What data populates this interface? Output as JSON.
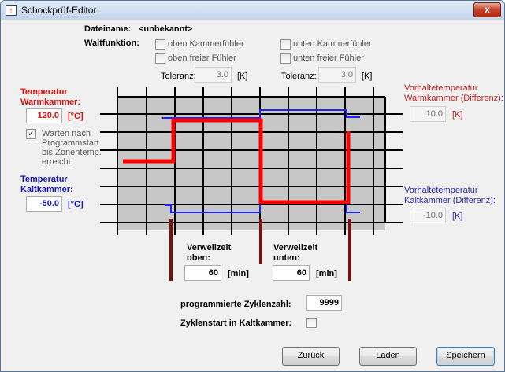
{
  "window": {
    "title": "Schockprüf-Editor",
    "close_glyph": "x"
  },
  "file": {
    "label": "Dateiname:",
    "value": "<unbekannt>"
  },
  "wait": {
    "label": "Waitfunktion:",
    "options": [
      {
        "label": "oben Kammerfühler",
        "checked": false
      },
      {
        "label": "oben freier Fühler",
        "checked": false
      },
      {
        "label": "unten Kammerfühler",
        "checked": false
      },
      {
        "label": "unten freier Fühler",
        "checked": false
      }
    ],
    "tol_label": "Toleranz:",
    "tol_left": "3.0",
    "tol_right": "3.0",
    "tol_unit": "[K]"
  },
  "warm": {
    "label1": "Temperatur",
    "label2": "Warmkammer:",
    "value": "120.0",
    "unit": "[°C]"
  },
  "wait_start": {
    "line1": "Warten nach",
    "line2": "Programmstart",
    "line3": "bis Zonentemp.",
    "line4": "erreicht",
    "checked": true
  },
  "cold": {
    "label1": "Temperatur",
    "label2": "Kaltkammer:",
    "value": "-50.0",
    "unit": "[°C]"
  },
  "vor_warm": {
    "line1": "Vorhaltetemperatur",
    "line2": "Warmkammer (Differenz):",
    "value": "10.0",
    "unit": "[K]"
  },
  "vor_cold": {
    "line1": "Vorhaltetemperatur",
    "line2": "Kaltkammer (Differenz):",
    "value": "-10.0",
    "unit": "[K]"
  },
  "dwell_top": {
    "line1": "Verweilzeit",
    "line2": "oben:",
    "value": "60",
    "unit": "[min]"
  },
  "dwell_bottom": {
    "line1": "Verweilzeit",
    "line2": "unten:",
    "value": "60",
    "unit": "[min]"
  },
  "cycles": {
    "label": "programmierte Zyklenzahl:",
    "value": "9999"
  },
  "cold_start": {
    "label": "Zyklenstart in Kaltkammer:",
    "checked": false
  },
  "buttons": {
    "back": "Zurück",
    "load": "Laden",
    "save": "Speichern"
  },
  "colors": {
    "profile": "#ff0000",
    "setpoint": "#2020ff",
    "marker": "#7a0f0f",
    "grid": "#000000"
  }
}
